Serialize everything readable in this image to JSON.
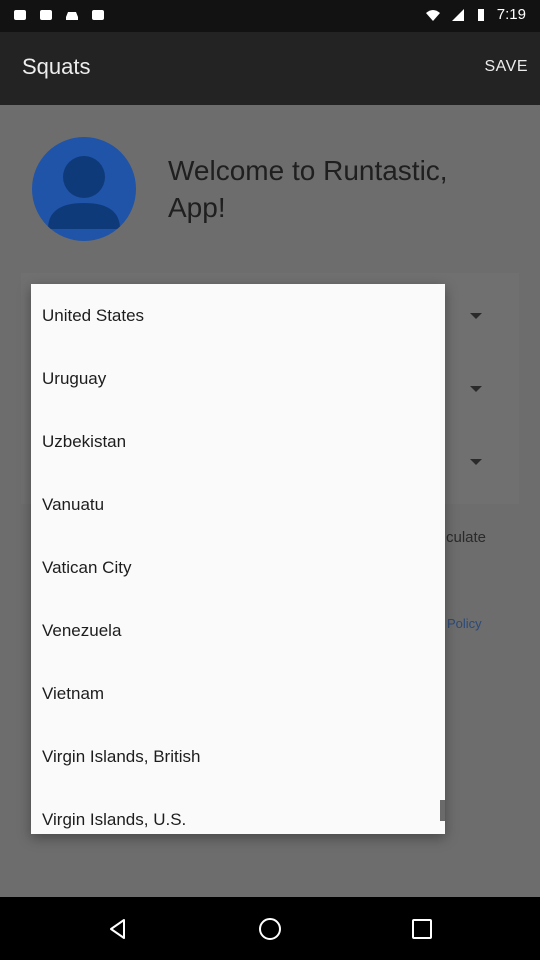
{
  "status_bar": {
    "time": "7:19"
  },
  "app_bar": {
    "title": "Squats",
    "save_label": "SAVE"
  },
  "welcome": {
    "text": "Welcome to Runtastic, App!"
  },
  "background": {
    "calc_fragment": "culate",
    "policy_fragment": "Policy"
  },
  "dropdown": {
    "items": [
      "United States",
      "Uruguay",
      "Uzbekistan",
      "Vanuatu",
      "Vatican City",
      "Venezuela",
      "Vietnam",
      "Virgin Islands, British",
      "Virgin Islands, U.S."
    ]
  },
  "icons": {
    "avatar": "person-icon",
    "nav_back": "back-icon",
    "nav_home": "home-icon",
    "nav_recents": "recents-icon"
  },
  "colors": {
    "accent": "#1f54a8",
    "appbar": "#232323"
  }
}
